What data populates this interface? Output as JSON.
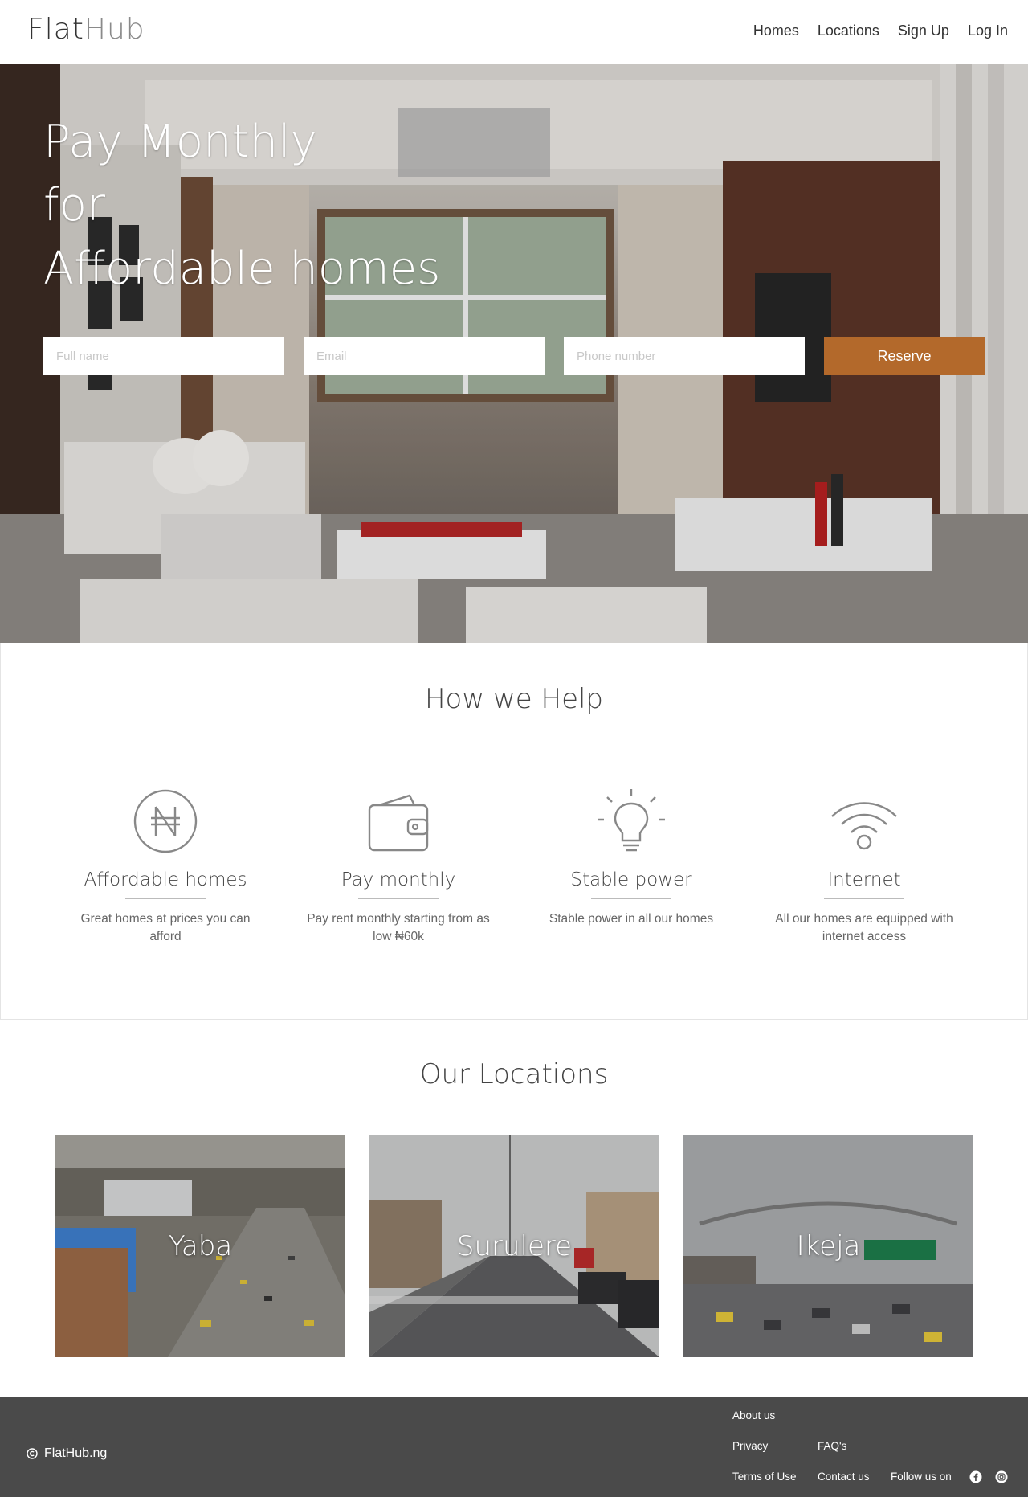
{
  "brand": {
    "part1": "Flat",
    "part2": "Hub"
  },
  "nav": {
    "items": [
      {
        "label": "Homes"
      },
      {
        "label": "Locations"
      },
      {
        "label": "Sign Up"
      },
      {
        "label": "Log In"
      }
    ]
  },
  "hero": {
    "line1": "Pay Monthly",
    "line2": "for",
    "line3": "Affordable homes",
    "form": {
      "full_name": {
        "placeholder": "Full name",
        "value": ""
      },
      "email": {
        "placeholder": "Email",
        "value": ""
      },
      "phone": {
        "placeholder": "Phone number",
        "value": ""
      },
      "reserve_label": "Reserve"
    }
  },
  "help": {
    "title": "How we Help",
    "features": [
      {
        "icon": "naira-icon",
        "title": "Affordable homes",
        "text": "Great homes at prices you can afford"
      },
      {
        "icon": "wallet-icon",
        "title": "Pay monthly",
        "text": "Pay rent monthly starting from as low ₦60k"
      },
      {
        "icon": "lightbulb-icon",
        "title": "Stable power",
        "text": "Stable power in all our homes"
      },
      {
        "icon": "wifi-icon",
        "title": "Internet",
        "text": "All our homes are equipped with internet access"
      }
    ]
  },
  "locations": {
    "title": "Our Locations",
    "items": [
      {
        "name": "Yaba"
      },
      {
        "name": "Surulere"
      },
      {
        "name": "Ikeja"
      }
    ]
  },
  "footer": {
    "copyright": "FlatHub.ng",
    "about": "About us",
    "privacy": "Privacy",
    "faqs": "FAQ's",
    "terms": "Terms of Use",
    "contact": "Contact us",
    "follow": "Follow us on"
  },
  "colors": {
    "accent": "#b3692b",
    "footer_bg": "#4a4a4a",
    "icon_gray": "#888888"
  }
}
